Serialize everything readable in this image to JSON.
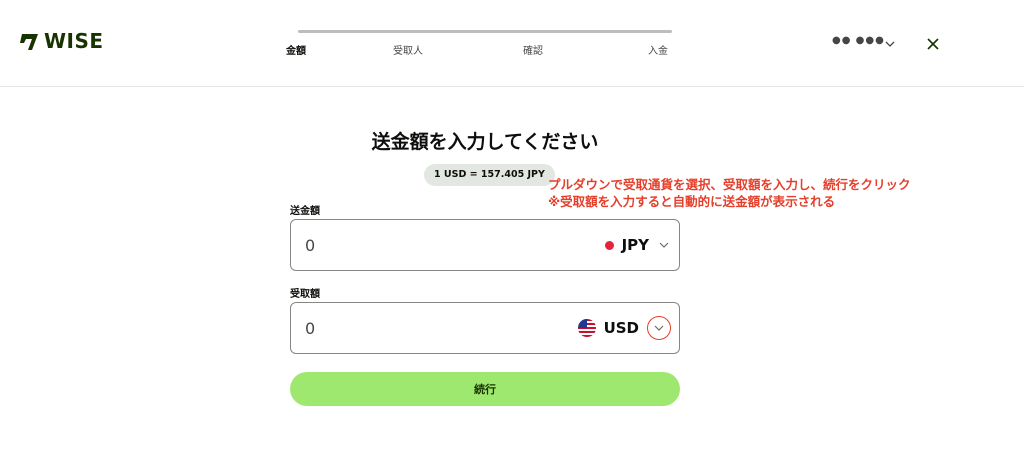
{
  "header": {
    "logo_text": "WISE",
    "steps": [
      {
        "label": "金額",
        "active": true
      },
      {
        "label": "受取人",
        "active": false
      },
      {
        "label": "確認",
        "active": false
      },
      {
        "label": "入金",
        "active": false
      }
    ],
    "masked_account": "●● ●●●",
    "brand_color": "#163300"
  },
  "main": {
    "title": "送金額を入力してください",
    "rate": "1 USD = 157.405 JPY",
    "send": {
      "label": "送金額",
      "value": "0",
      "currency": "JPY"
    },
    "receive": {
      "label": "受取額",
      "value": "0",
      "currency": "USD"
    },
    "continue_label": "続行"
  },
  "annotation": {
    "line1": "プルダウンで受取通貨を選択、受取額を入力し、続行をクリック",
    "line2": "※受取額を入力すると自動的に送金額が表示される",
    "color": "#e53e2a"
  },
  "colors": {
    "accent_green": "#9fe870",
    "rate_chip_bg": "#e3e7e1"
  },
  "icons": [
    "wise-logo-icon",
    "chevron-down-icon",
    "close-icon",
    "japan-flag-icon",
    "us-flag-icon"
  ]
}
